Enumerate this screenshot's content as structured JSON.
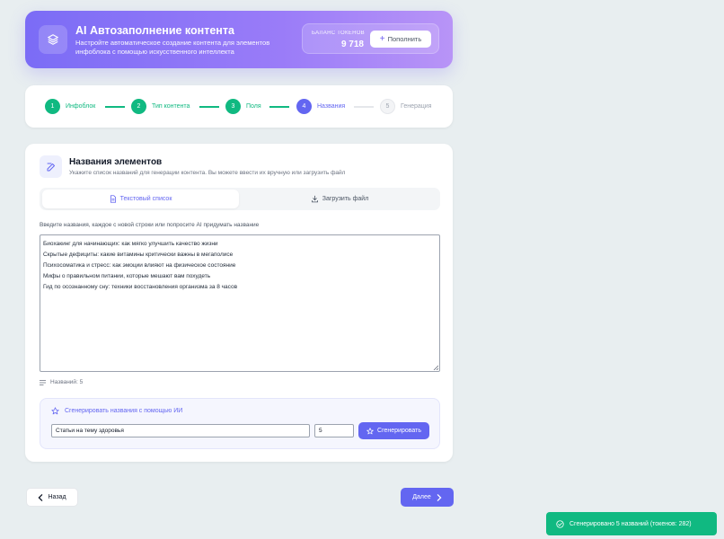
{
  "header": {
    "title": "AI Автозаполнение контента",
    "description": "Настройте автоматическое создание контента для элементов инфоблока с помощью искусственного интеллекта",
    "balance_label": "БАЛАНС ТОКЕНОВ",
    "balance_value": "9 718",
    "topup_label": "Пополнить"
  },
  "steps": [
    {
      "num": "1",
      "label": "Инфоблок",
      "state": "done"
    },
    {
      "num": "2",
      "label": "Тип контента",
      "state": "done"
    },
    {
      "num": "3",
      "label": "Поля",
      "state": "done"
    },
    {
      "num": "4",
      "label": "Названия",
      "state": "active"
    },
    {
      "num": "5",
      "label": "Генерация",
      "state": "pending"
    }
  ],
  "section": {
    "title": "Названия элементов",
    "subtitle": "Укажите список названий для генерации контента. Вы можете ввести их вручную или загрузить файл"
  },
  "tabs": {
    "text_list": "Текстовый список",
    "upload_file": "Загрузить файл"
  },
  "field_label": "Введите названия, каждое с новой строки или попросите AI придумать название",
  "names": [
    "Биохакинг для начинающих: как мягко улучшить качество жизни",
    "Скрытые дефициты: какие витамины критически важны в мегаполисе",
    "Психосоматика и стресс: как эмоции влияют на физическое состояние",
    "Мифы о правильном питании, которые мешают вам похудеть",
    "Гид по осознанному сну: техники восстановления организма за 8 часов"
  ],
  "count_label": "Названий: 5",
  "generator": {
    "title": "Сгенерировать названия с помощью ИИ",
    "prompt_value": "Статьи на тему здоровья",
    "quantity_value": "5",
    "button_label": "Сгенерировать"
  },
  "nav": {
    "back_label": "Назад",
    "next_label": "Далее"
  },
  "toast": {
    "message": "Сгенерировано 5 названий (токенов: 282)"
  },
  "colors": {
    "accent": "#6366f1",
    "success": "#10b981",
    "header_gradient_start": "#7b6cf6",
    "header_gradient_end": "#b894f7"
  }
}
